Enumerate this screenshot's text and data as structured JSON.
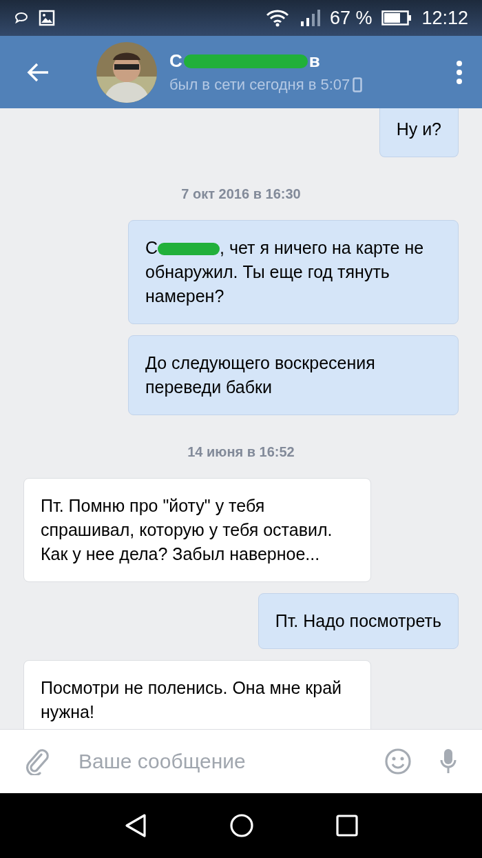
{
  "status_bar": {
    "battery": "67 %",
    "time": "12:12"
  },
  "header": {
    "name_start": "С",
    "name_end": "в",
    "name_redacted": true,
    "last_seen": "был в сети сегодня в 5:07"
  },
  "messages": [
    {
      "kind": "message",
      "outgoing": true,
      "text": "Ну и?"
    },
    {
      "kind": "date",
      "text": "7 окт 2016 в 16:30"
    },
    {
      "kind": "message",
      "outgoing": true,
      "redacted_prefix": "С",
      "text": ", чет я ничего на карте не обнаружил. Ты еще год тянуть намерен?"
    },
    {
      "kind": "message",
      "outgoing": true,
      "text": "До следующего воскресения переведи бабки"
    },
    {
      "kind": "date",
      "text": "14 июня в 16:52"
    },
    {
      "kind": "message",
      "outgoing": false,
      "text": "Пт. Помню про \"йоту\" у тебя спрашивал, которую у тебя оставил. Как у нее дела? Забыл наверное..."
    },
    {
      "kind": "message",
      "outgoing": true,
      "text": "Пт. Надо посмотреть"
    },
    {
      "kind": "message",
      "outgoing": false,
      "text": "Посмотри не поленись. Она мне край нужна!"
    }
  ],
  "composer": {
    "placeholder": "Ваше сообщение"
  }
}
